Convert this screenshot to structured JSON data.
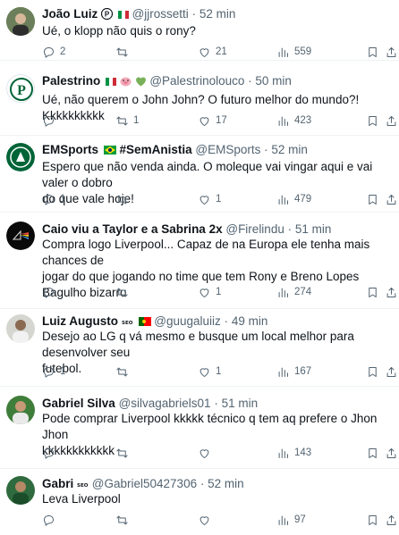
{
  "tweets": [
    {
      "name": "João Luiz",
      "handle": "@jjrossetti",
      "sep": "·",
      "time": "52 min",
      "text_lines": [
        "Ué, o klopp não quis o rony?"
      ],
      "replies": "2",
      "retweets": "",
      "likes": "21",
      "views": "559"
    },
    {
      "name": "Palestrino",
      "handle": "@Palestrinolouco",
      "sep": "·",
      "time": "50 min",
      "text_lines": [
        "Ué, não querem o John John? O futuro melhor do mundo?! Kkkkkkkkkk"
      ],
      "replies": "",
      "retweets": "1",
      "likes": "17",
      "views": "423"
    },
    {
      "name": "EMSports",
      "name_suffix": "#SemAnistia",
      "handle": "@EMSports",
      "sep": "·",
      "time": "52 min",
      "text_lines": [
        "Espero que não venda ainda. O moleque vai vingar aqui e vai valer o dobro",
        "do que vale hoje!"
      ],
      "replies": "1",
      "retweets": "",
      "likes": "1",
      "views": "479"
    },
    {
      "name": "Caio viu a Taylor e a Sabrina 2x",
      "handle": "@Firelindu",
      "sep": "·",
      "time": "51 min",
      "text_lines": [
        "Compra logo Liverpool... Capaz de na Europa ele tenha mais chances de",
        "jogar do que jogando no time que tem Rony e Breno Lopes",
        "Bagulho bizarro"
      ],
      "replies": "",
      "retweets": "",
      "likes": "1",
      "views": "274"
    },
    {
      "name": "Luiz Augusto",
      "handle": "@guugaluiiz",
      "sep": "·",
      "time": "49 min",
      "text_lines": [
        "Desejo ao LG q vá mesmo e busque um local melhor para desenvolver seu",
        "futebol."
      ],
      "replies": "1",
      "retweets": "",
      "likes": "1",
      "views": "167"
    },
    {
      "name": "Gabriel Silva",
      "handle": "@silvagabriels01",
      "sep": "·",
      "time": "51 min",
      "text_lines": [
        "Pode comprar Liverpool kkkkk técnico q tem aq prefere o Jhon Jhon",
        "kkkkkkkkkkkk"
      ],
      "replies": "",
      "retweets": "",
      "likes": "",
      "views": "143"
    },
    {
      "name": "Gabri",
      "handle": "@Gabriel50427306",
      "sep": "·",
      "time": "52 min",
      "text_lines": [
        "Leva Liverpool"
      ],
      "replies": "",
      "retweets": "",
      "likes": "",
      "views": "97"
    }
  ],
  "colors": {
    "text": "#0f1419",
    "secondary": "#536471",
    "divider": "#eff3f4",
    "palmeiras_green": "#006437"
  },
  "icons": [
    "reply-icon",
    "retweet-icon",
    "like-icon",
    "views-icon",
    "bookmark-icon",
    "share-icon"
  ]
}
